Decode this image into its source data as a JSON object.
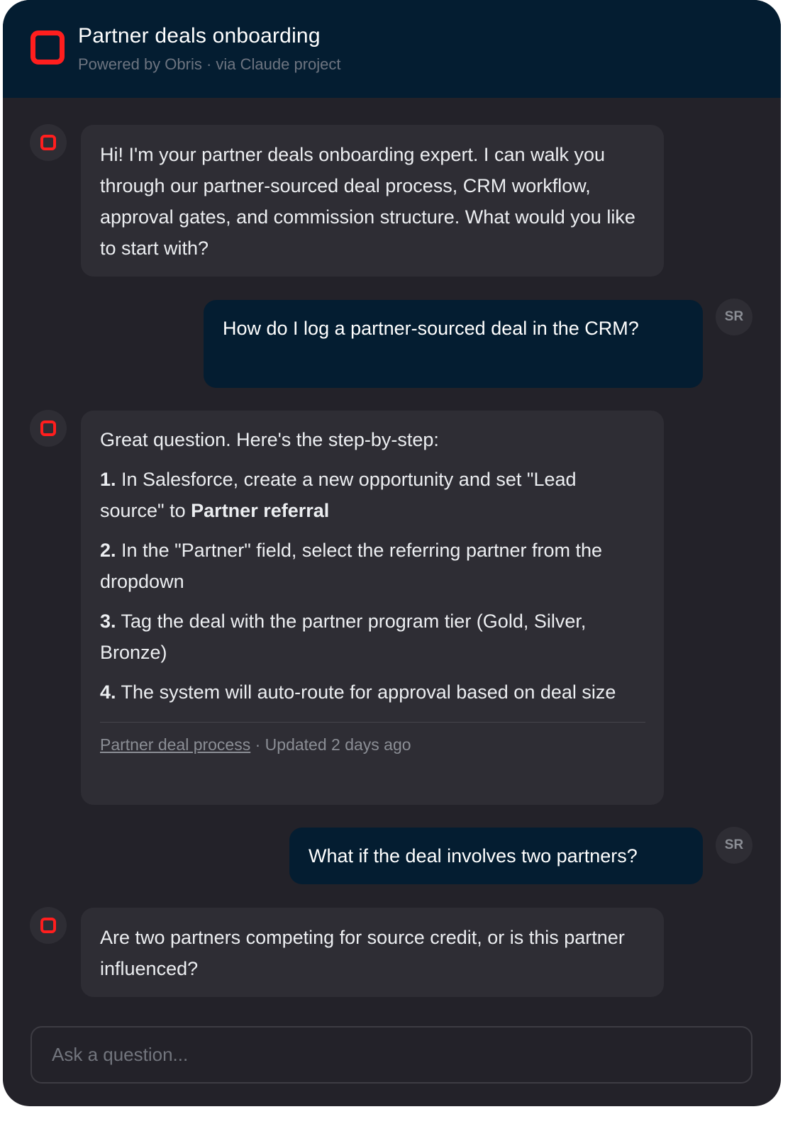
{
  "header": {
    "title": "Partner deals onboarding",
    "subtitle": "Powered by Obris · via Claude project"
  },
  "user": {
    "initials": "SR"
  },
  "messages": {
    "m1": "Hi! I'm your partner deals onboarding expert. I can walk you through our partner-sourced deal process, CRM workflow, approval gates, and commission structure. What would you like to start with?",
    "m2": "How do I log a partner-sourced deal in the CRM?",
    "m3": {
      "intro": "Great question. Here's the step-by-step:",
      "steps": [
        {
          "num": "1.",
          "text": " In Salesforce, create a new opportunity and set \"Lead source\" to ",
          "bold": "Partner referral"
        },
        {
          "num": "2.",
          "text": " In the \"Partner\" field, select the referring partner from the dropdown"
        },
        {
          "num": "3.",
          "text": " Tag the deal with the partner program tier (Gold, Silver, Bronze)"
        },
        {
          "num": "4.",
          "text": " The system will auto-route for approval based on deal size"
        }
      ],
      "source_link": "Partner deal process",
      "source_meta": " · Updated 2 days ago"
    },
    "m4": "What if the deal involves two partners?",
    "m5": "Are two partners competing for source credit, or is this partner influenced?"
  },
  "composer": {
    "placeholder": "Ask a question..."
  },
  "colors": {
    "background": "#232229",
    "header": "#041d31",
    "bot_bubble": "#2e2d34",
    "user_bubble": "#041d31",
    "accent": "#ff1e1e"
  }
}
